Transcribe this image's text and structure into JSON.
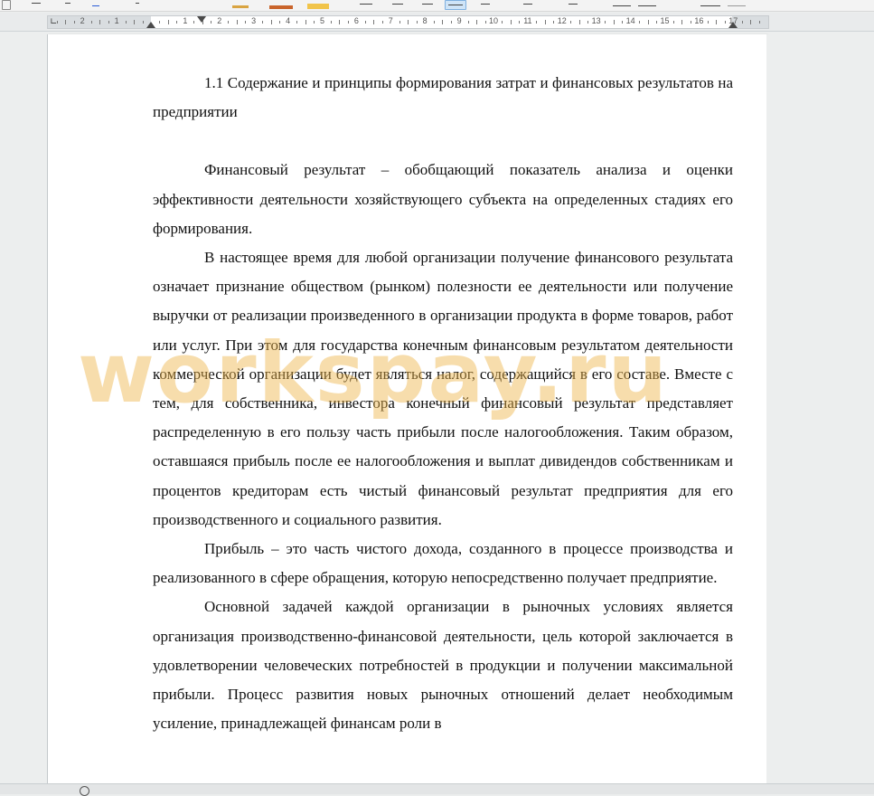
{
  "ruler": {
    "numbers": [
      "2",
      "1",
      "1",
      "2",
      "3",
      "4",
      "5",
      "6",
      "7",
      "8",
      "9",
      "10",
      "11",
      "12",
      "13",
      "14",
      "15",
      "16",
      "17"
    ]
  },
  "document": {
    "heading": "1.1 Содержание и принципы формирования затрат и финансовых результатов на предприятии",
    "paragraphs": [
      "Финансовый результат – обобщающий показатель анализа и оценки эффективности деятельности хозяйствующего субъекта на определенных стадиях его формирования.",
      "В настоящее время для любой организации получение финансового результата означает признание обществом (рынком) полезности ее деятельности или получение выручки от реализации произведенного в организации продукта в форме товаров, работ или услуг. При этом для государства конечным финансовым результатом деятельности коммерческой организации будет являться налог, содержащийся в его составе. Вместе с тем, для собственника, инвестора конечный финансовый результат представляет распределенную в его пользу часть прибыли после налогообложения. Таким образом, оставшаяся прибыль после ее налогообложения и выплат дивидендов собственникам и процентов кредиторам есть чистый финансовый результат предприятия для его производственного и социального развития.",
      "Прибыль – это часть чистого дохода, созданного в процессе производства и реализованного в сфере обращения, которую непосредственно получает предприятие.",
      "Основной задачей каждой организации в рыночных условиях является организация производственно-финансовой деятельности, цель которой заключается в удовлетворении человеческих потребностей в продукции и получении максимальной прибыли. Процесс развития новых рыночных отношений делает необходимым усиление, принадлежащей финансам роли в"
    ]
  },
  "watermark": "workspay.ru",
  "colors": {
    "watermark": "#eeb446",
    "page": "#ffffff",
    "workspace": "#eceeee"
  }
}
